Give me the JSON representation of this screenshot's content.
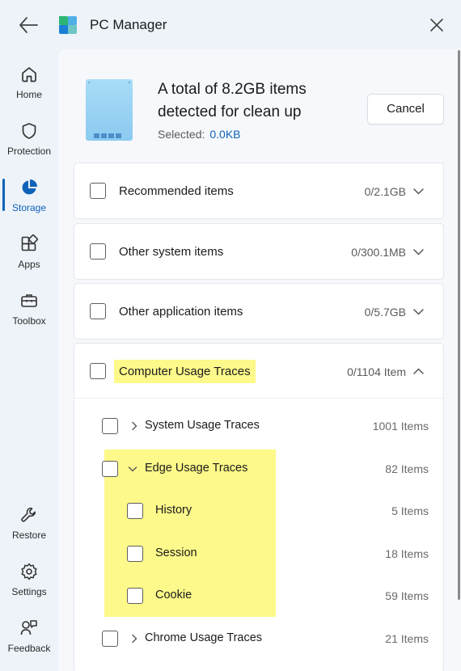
{
  "app": {
    "title": "PC Manager"
  },
  "sidebar": {
    "items": [
      {
        "label": "Home",
        "icon": "home-icon",
        "active": false
      },
      {
        "label": "Protection",
        "icon": "shield-icon",
        "active": false
      },
      {
        "label": "Storage",
        "icon": "pie-chart-icon",
        "active": true
      },
      {
        "label": "Apps",
        "icon": "apps-icon",
        "active": false
      },
      {
        "label": "Toolbox",
        "icon": "toolbox-icon",
        "active": false
      },
      {
        "label": "Restore",
        "icon": "wrench-icon",
        "active": false
      },
      {
        "label": "Settings",
        "icon": "gear-icon",
        "active": false
      },
      {
        "label": "Feedback",
        "icon": "feedback-icon",
        "active": false
      }
    ]
  },
  "header": {
    "headline": "A total of 8.2GB items detected for clean up",
    "selected_label": "Selected:",
    "selected_value": "0.0KB",
    "cancel_label": "Cancel"
  },
  "categories": [
    {
      "label": "Recommended items",
      "value": "0/2.1GB",
      "expanded": false
    },
    {
      "label": "Other system items",
      "value": "0/300.1MB",
      "expanded": false
    },
    {
      "label": "Other application items",
      "value": "0/5.7GB",
      "expanded": false
    },
    {
      "label": "Computer Usage Traces",
      "value": "0/1104 Item",
      "expanded": true,
      "children": [
        {
          "label": "System Usage Traces",
          "count": "1001 Items",
          "expanded": false
        },
        {
          "label": "Edge Usage Traces",
          "count": "82 Items",
          "expanded": true,
          "children": [
            {
              "label": "History",
              "count": "5 Items"
            },
            {
              "label": "Session",
              "count": "18 Items"
            },
            {
              "label": "Cookie",
              "count": "59 Items"
            }
          ]
        },
        {
          "label": "Chrome Usage Traces",
          "count": "21 Items",
          "expanded": false
        }
      ]
    }
  ],
  "colors": {
    "accent": "#0f62b8",
    "highlight": "#fdf98a",
    "background": "#eef3f9"
  }
}
